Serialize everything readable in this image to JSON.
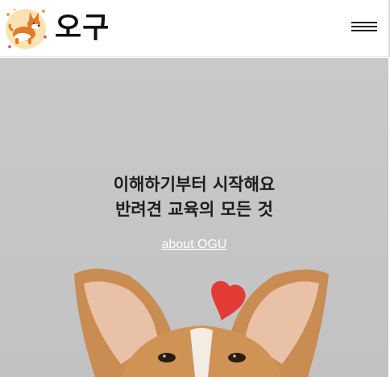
{
  "header": {
    "logo_text": "오구",
    "menu_icon": "hamburger-menu-icon"
  },
  "hero": {
    "title_line1": "이해하기부터 시작해요",
    "title_line2": "반려견 교육의 모든 것",
    "about_link": "about OGU"
  },
  "colors": {
    "header_bg": "#ffffff",
    "hero_bg": "#c6c6c6",
    "logo_circle": "#fbe3b1",
    "dog_fur": "#d49a58",
    "heart": "#e23b36",
    "link_text": "#ffffff"
  }
}
